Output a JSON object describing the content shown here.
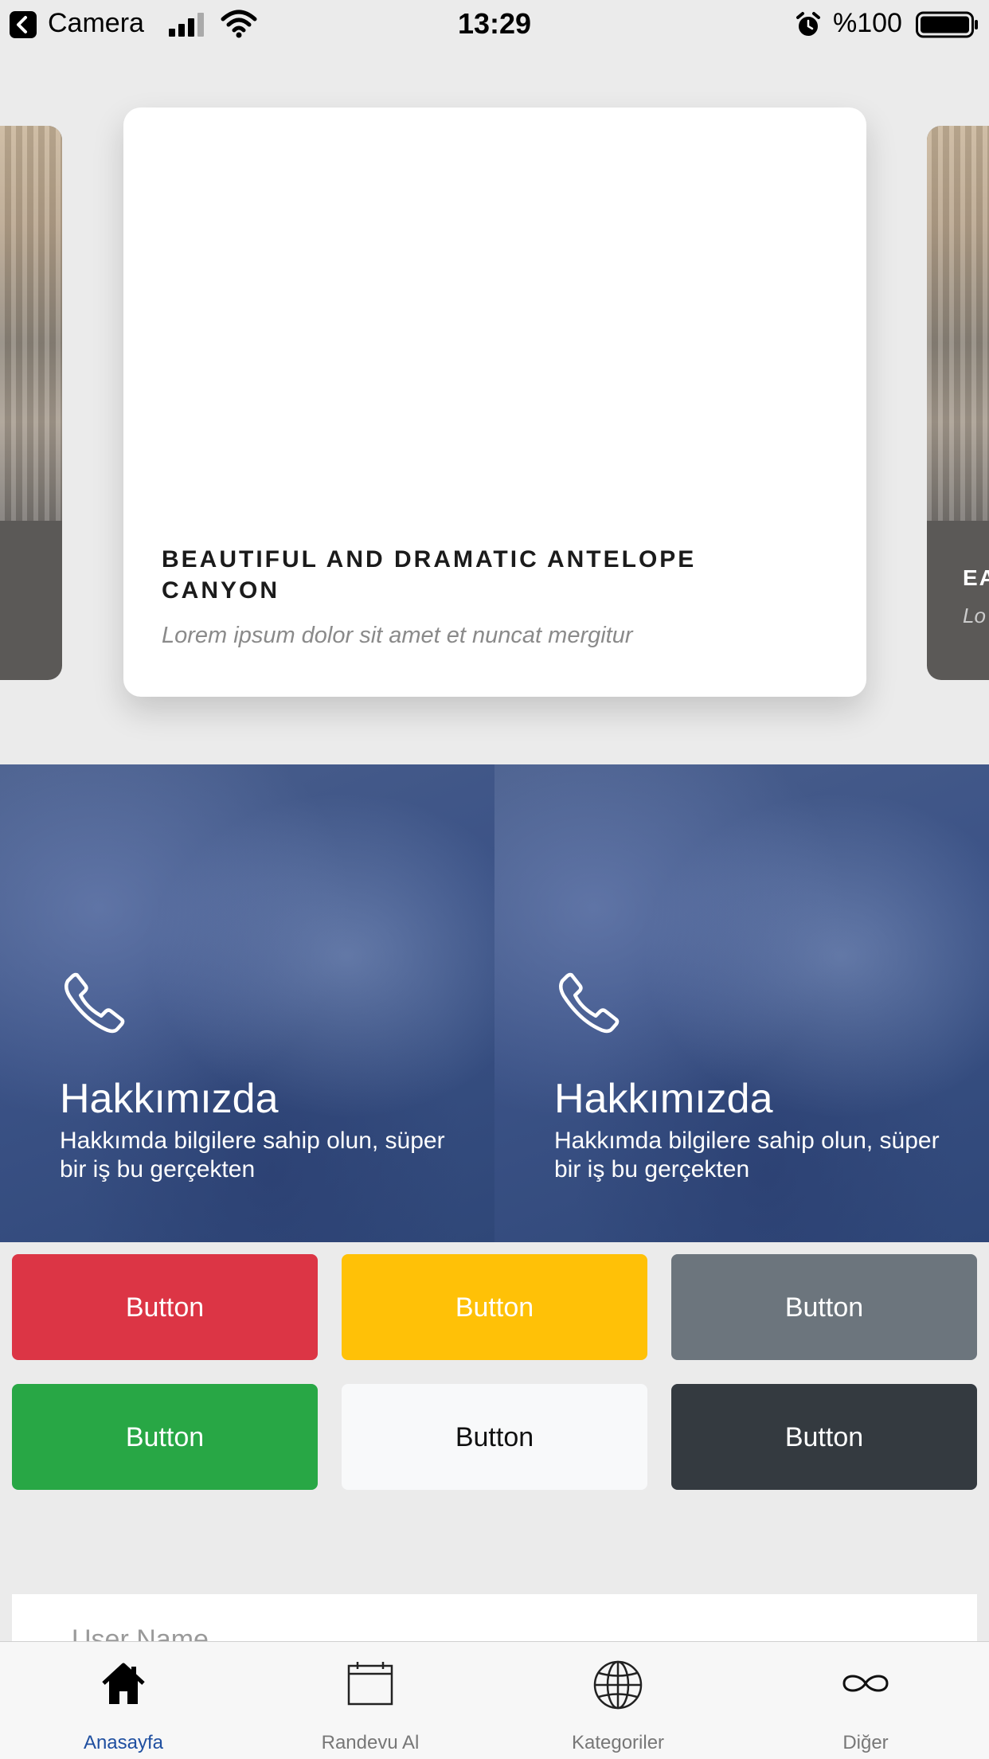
{
  "status_bar": {
    "back_app": "Camera",
    "time": "13:29",
    "battery": "%100"
  },
  "carousel": {
    "main_card": {
      "title": "BEAUTIFUL AND DRAMATIC ANTELOPE CANYON",
      "subtitle": "Lorem ipsum dolor sit amet et nuncat mergitur"
    },
    "right_card": {
      "title": "EA",
      "subtitle": "Lo"
    }
  },
  "promos": [
    {
      "heading": "Hakkımızda",
      "description": "Hakkımda bilgilere sahip olun, süper bir iş bu gerçekten"
    },
    {
      "heading": "Hakkımızda",
      "description": "Hakkımda bilgilere sahip olun, süper bir iş bu gerçekten"
    }
  ],
  "buttons": [
    {
      "label": "Button",
      "color": "#dc3545"
    },
    {
      "label": "Button",
      "color": "#ffc107"
    },
    {
      "label": "Button",
      "color": "#6c757d"
    },
    {
      "label": "Button",
      "color": "#28a745"
    },
    {
      "label": "Button",
      "color": "#f8f9fa"
    },
    {
      "label": "Button",
      "color": "#343a40"
    }
  ],
  "form": {
    "username_placeholder": "User Name"
  },
  "tabbar": {
    "active_color": "#1f4fa0",
    "tabs": [
      {
        "label": "Anasayfa",
        "icon": "home-icon",
        "active": true
      },
      {
        "label": "Randevu Al",
        "icon": "calendar-icon",
        "active": false
      },
      {
        "label": "Kategoriler",
        "icon": "globe-icon",
        "active": false
      },
      {
        "label": "Diğer",
        "icon": "infinity-icon",
        "active": false
      }
    ]
  }
}
